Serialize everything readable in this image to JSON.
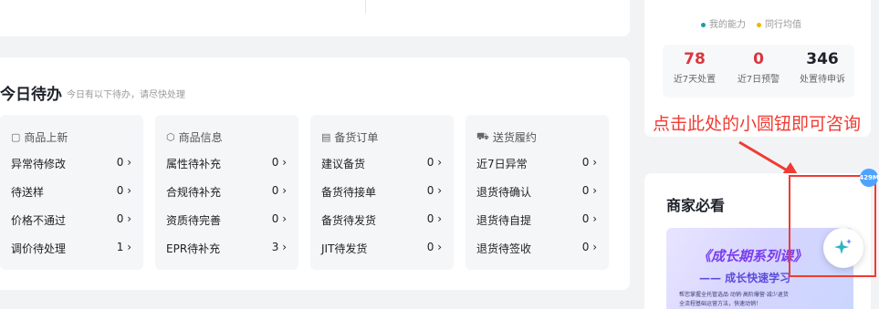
{
  "todo": {
    "title": "今日待办",
    "subtitle": "今日有以下待办，请尽快处理",
    "columns": [
      {
        "header": "商品上新",
        "icon": "box-icon",
        "rows": [
          {
            "label": "异常待修改",
            "count": "0 ›"
          },
          {
            "label": "待送样",
            "count": "0 ›"
          },
          {
            "label": "价格不通过",
            "count": "0 ›"
          },
          {
            "label": "调价待处理",
            "count": "1 ›"
          }
        ]
      },
      {
        "header": "商品信息",
        "icon": "cube-icon",
        "rows": [
          {
            "label": "属性待补充",
            "count": "0 ›"
          },
          {
            "label": "合规待补充",
            "count": "0 ›"
          },
          {
            "label": "资质待完善",
            "count": "0 ›"
          },
          {
            "label": "EPR待补充",
            "count": "3 ›"
          }
        ]
      },
      {
        "header": "备货订单",
        "icon": "document-icon",
        "rows": [
          {
            "label": "建议备货",
            "count": "0 ›"
          },
          {
            "label": "备货待接单",
            "count": "0 ›"
          },
          {
            "label": "备货待发货",
            "count": "0 ›"
          },
          {
            "label": "JIT待发货",
            "count": "0 ›"
          }
        ]
      },
      {
        "header": "送货履约",
        "icon": "truck-icon",
        "rows": [
          {
            "label": "近7日异常",
            "count": "0 ›"
          },
          {
            "label": "退货待确认",
            "count": "0 ›"
          },
          {
            "label": "退货待自提",
            "count": "0 ›"
          },
          {
            "label": "退货待签收",
            "count": "0 ›"
          }
        ]
      }
    ]
  },
  "ability": {
    "legend_mine": "我的能力",
    "legend_peer": "同行均值",
    "color_mine": "#1a9cb0",
    "color_peer": "#f0b400",
    "stats": [
      {
        "value": "78",
        "label": "近7天处置",
        "color": "#d9363e"
      },
      {
        "value": "0",
        "label": "近7日预警",
        "color": "#d9363e"
      },
      {
        "value": "346",
        "label": "处置待申诉",
        "color": "#1d2129"
      }
    ]
  },
  "hint": {
    "text": "点击此处的小圆钮即可咨询",
    "color": "#f03b33"
  },
  "merchant": {
    "title": "商家必看",
    "banner_title": "《成长期系列课》",
    "banner_sub": "—— 成长快速学习",
    "banner_line1": "帮您掌握全托管选品·动销·高阶爆营·减少退货",
    "banner_line2": "全流程基础运营方法，快速动销！"
  },
  "assistant": {
    "badge": "429M",
    "icon": "sparkle-icon"
  }
}
